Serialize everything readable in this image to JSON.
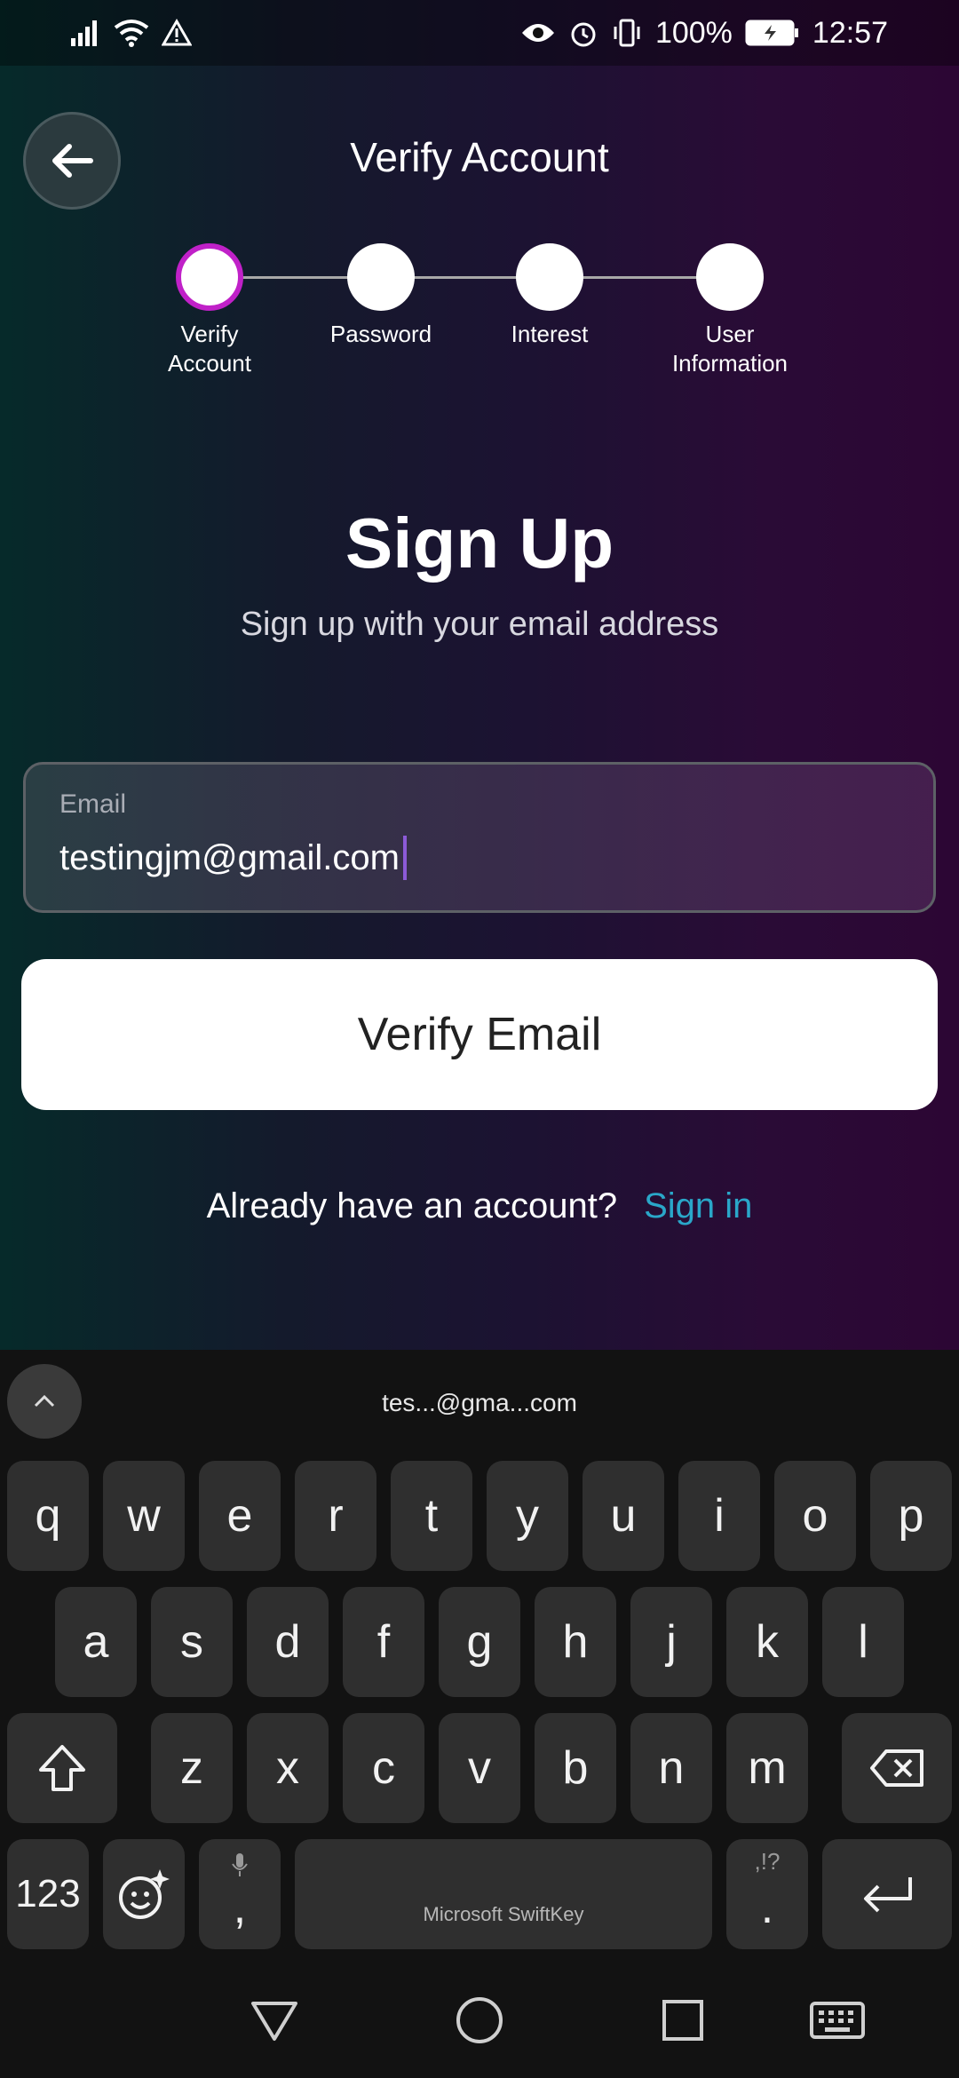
{
  "status_bar": {
    "battery": "100%",
    "time": "12:57",
    "icons": [
      "signal-icon",
      "wifi-icon",
      "warning-icon",
      "eye-icon",
      "alarm-icon",
      "vibrate-icon",
      "battery-charging-icon"
    ]
  },
  "header": {
    "title": "Verify Account",
    "back_icon": "arrow-left-icon"
  },
  "stepper": {
    "steps": [
      {
        "label": "Verify\nAccount",
        "active": true
      },
      {
        "label": "Password",
        "active": false
      },
      {
        "label": "Interest",
        "active": false
      },
      {
        "label": "User\nInformation",
        "active": false
      }
    ]
  },
  "main": {
    "title": "Sign Up",
    "subtitle": "Sign up with your email address",
    "email_label": "Email",
    "email_value": "testingjm@gmail.com",
    "verify_button": "Verify Email",
    "signin_prompt": "Already have an account?",
    "signin_link": "Sign in"
  },
  "colors": {
    "accent_link": "#2aa7c9",
    "step_active_ring": "#c021c8",
    "caret": "#8c5ad8"
  },
  "keyboard": {
    "suggestion": "tes...@gma...com",
    "row1": [
      "q",
      "w",
      "e",
      "r",
      "t",
      "y",
      "u",
      "i",
      "o",
      "p"
    ],
    "row2": [
      "a",
      "s",
      "d",
      "f",
      "g",
      "h",
      "j",
      "k",
      "l"
    ],
    "row3": [
      "z",
      "x",
      "c",
      "v",
      "b",
      "n",
      "m"
    ],
    "numbers_key": "123",
    "comma_key": ",",
    "period_key": ".",
    "punct_hint": ",!?",
    "space_label": "Microsoft SwiftKey"
  }
}
